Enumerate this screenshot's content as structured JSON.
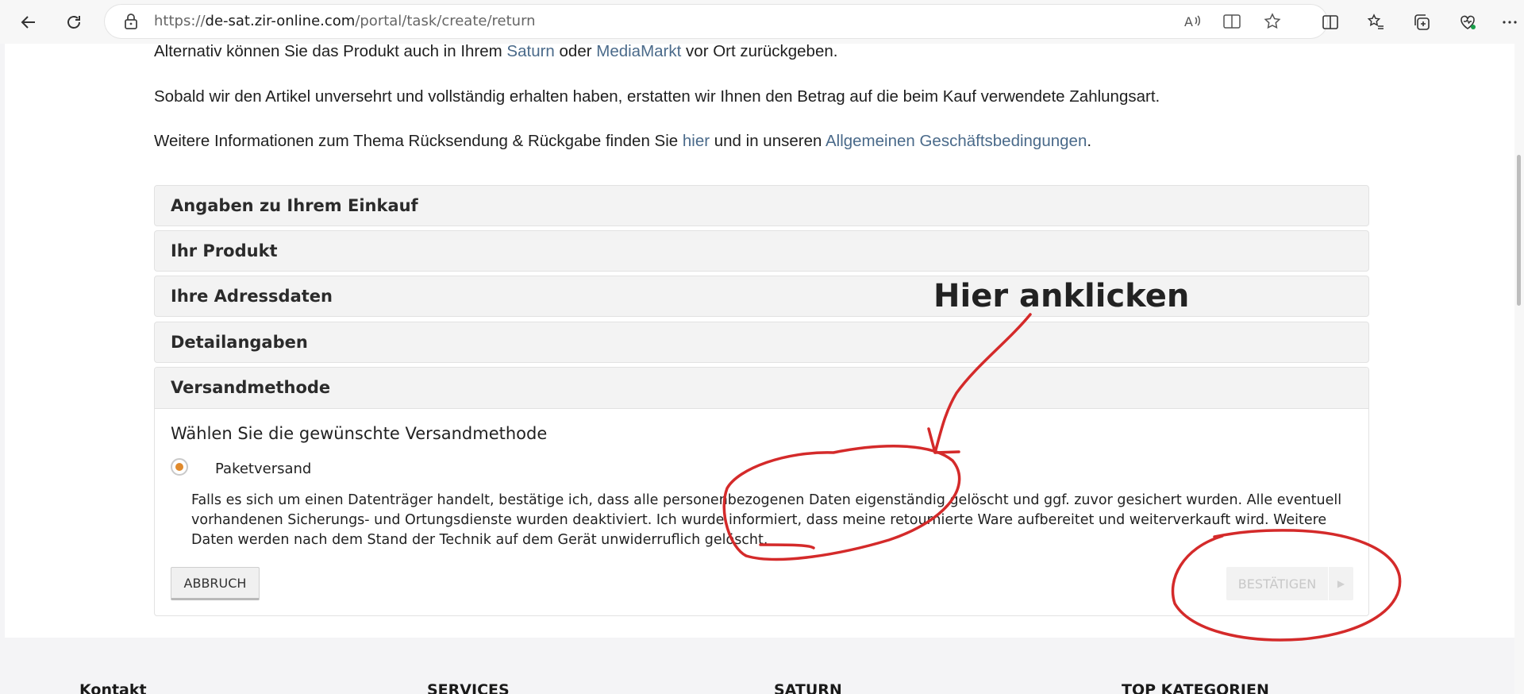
{
  "browser": {
    "url_prefix": "https://",
    "url_host": "de-sat.zir-online.com",
    "url_path": "/portal/task/create/return"
  },
  "intro": {
    "line1_a": "Alternativ können Sie das Produkt auch in Ihrem ",
    "line1_link1": "Saturn",
    "line1_b": " oder ",
    "line1_link2": "MediaMarkt",
    "line1_c": " vor Ort zurückgeben.",
    "line2": "Sobald wir den Artikel unversehrt und vollständig erhalten haben, erstatten wir Ihnen den Betrag auf die beim Kauf verwendete Zahlungsart.",
    "line3_a": "Weitere Informationen zum Thema Rücksendung & Rückgabe finden Sie ",
    "line3_link1": "hier",
    "line3_b": " und in unseren ",
    "line3_link2": "Allgemeinen Geschäftsbedingungen",
    "line3_c": "."
  },
  "accordion": [
    {
      "title": "Angaben zu Ihrem Einkauf"
    },
    {
      "title": "Ihr Produkt"
    },
    {
      "title": "Ihre Adressdaten"
    },
    {
      "title": "Detailangaben"
    }
  ],
  "shipping": {
    "title": "Versandmethode",
    "prompt": "Wählen Sie die gewünschte Versandmethode",
    "option_label": "Paketversand",
    "option_selected": true,
    "disclaimer": "Falls es sich um einen Datenträger handelt, bestätige ich, dass alle personenbezogenen Daten eigenständig gelöscht und ggf. zuvor gesichert wurden. Alle eventuell vorhandenen Sicherungs- und Ortungsdienste wurden deaktiviert. Ich wurde informiert, dass meine retournierte Ware aufbereitet und weiterverkauft wird. Weitere Daten werden nach dem Stand der Technik auf dem Gerät unwiderruflich gelöscht.",
    "cancel_label": "ABBRUCH",
    "confirm_label": "BESTÄTIGEN",
    "confirm_enabled": false
  },
  "footer": {
    "col1": "Kontakt",
    "col2": "SERVICES",
    "col3": "SATURN",
    "col4": "TOP KATEGORIEN"
  },
  "annotation": {
    "text": "Hier anklicken",
    "color": "#d42a2a"
  },
  "colors": {
    "link": "#4a6a8a",
    "radio_selected": "#e08a2c"
  }
}
